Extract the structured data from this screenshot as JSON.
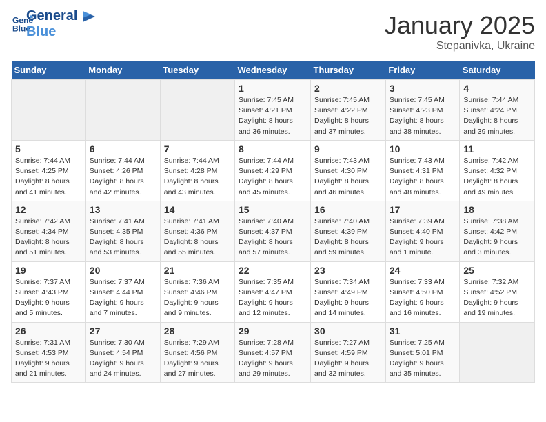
{
  "header": {
    "logo_line1": "General",
    "logo_line2": "Blue",
    "month": "January 2025",
    "location": "Stepanivka, Ukraine"
  },
  "weekdays": [
    "Sunday",
    "Monday",
    "Tuesday",
    "Wednesday",
    "Thursday",
    "Friday",
    "Saturday"
  ],
  "weeks": [
    [
      {
        "day": "",
        "info": ""
      },
      {
        "day": "",
        "info": ""
      },
      {
        "day": "",
        "info": ""
      },
      {
        "day": "1",
        "info": "Sunrise: 7:45 AM\nSunset: 4:21 PM\nDaylight: 8 hours and 36 minutes."
      },
      {
        "day": "2",
        "info": "Sunrise: 7:45 AM\nSunset: 4:22 PM\nDaylight: 8 hours and 37 minutes."
      },
      {
        "day": "3",
        "info": "Sunrise: 7:45 AM\nSunset: 4:23 PM\nDaylight: 8 hours and 38 minutes."
      },
      {
        "day": "4",
        "info": "Sunrise: 7:44 AM\nSunset: 4:24 PM\nDaylight: 8 hours and 39 minutes."
      }
    ],
    [
      {
        "day": "5",
        "info": "Sunrise: 7:44 AM\nSunset: 4:25 PM\nDaylight: 8 hours and 41 minutes."
      },
      {
        "day": "6",
        "info": "Sunrise: 7:44 AM\nSunset: 4:26 PM\nDaylight: 8 hours and 42 minutes."
      },
      {
        "day": "7",
        "info": "Sunrise: 7:44 AM\nSunset: 4:28 PM\nDaylight: 8 hours and 43 minutes."
      },
      {
        "day": "8",
        "info": "Sunrise: 7:44 AM\nSunset: 4:29 PM\nDaylight: 8 hours and 45 minutes."
      },
      {
        "day": "9",
        "info": "Sunrise: 7:43 AM\nSunset: 4:30 PM\nDaylight: 8 hours and 46 minutes."
      },
      {
        "day": "10",
        "info": "Sunrise: 7:43 AM\nSunset: 4:31 PM\nDaylight: 8 hours and 48 minutes."
      },
      {
        "day": "11",
        "info": "Sunrise: 7:42 AM\nSunset: 4:32 PM\nDaylight: 8 hours and 49 minutes."
      }
    ],
    [
      {
        "day": "12",
        "info": "Sunrise: 7:42 AM\nSunset: 4:34 PM\nDaylight: 8 hours and 51 minutes."
      },
      {
        "day": "13",
        "info": "Sunrise: 7:41 AM\nSunset: 4:35 PM\nDaylight: 8 hours and 53 minutes."
      },
      {
        "day": "14",
        "info": "Sunrise: 7:41 AM\nSunset: 4:36 PM\nDaylight: 8 hours and 55 minutes."
      },
      {
        "day": "15",
        "info": "Sunrise: 7:40 AM\nSunset: 4:37 PM\nDaylight: 8 hours and 57 minutes."
      },
      {
        "day": "16",
        "info": "Sunrise: 7:40 AM\nSunset: 4:39 PM\nDaylight: 8 hours and 59 minutes."
      },
      {
        "day": "17",
        "info": "Sunrise: 7:39 AM\nSunset: 4:40 PM\nDaylight: 9 hours and 1 minute."
      },
      {
        "day": "18",
        "info": "Sunrise: 7:38 AM\nSunset: 4:42 PM\nDaylight: 9 hours and 3 minutes."
      }
    ],
    [
      {
        "day": "19",
        "info": "Sunrise: 7:37 AM\nSunset: 4:43 PM\nDaylight: 9 hours and 5 minutes."
      },
      {
        "day": "20",
        "info": "Sunrise: 7:37 AM\nSunset: 4:44 PM\nDaylight: 9 hours and 7 minutes."
      },
      {
        "day": "21",
        "info": "Sunrise: 7:36 AM\nSunset: 4:46 PM\nDaylight: 9 hours and 9 minutes."
      },
      {
        "day": "22",
        "info": "Sunrise: 7:35 AM\nSunset: 4:47 PM\nDaylight: 9 hours and 12 minutes."
      },
      {
        "day": "23",
        "info": "Sunrise: 7:34 AM\nSunset: 4:49 PM\nDaylight: 9 hours and 14 minutes."
      },
      {
        "day": "24",
        "info": "Sunrise: 7:33 AM\nSunset: 4:50 PM\nDaylight: 9 hours and 16 minutes."
      },
      {
        "day": "25",
        "info": "Sunrise: 7:32 AM\nSunset: 4:52 PM\nDaylight: 9 hours and 19 minutes."
      }
    ],
    [
      {
        "day": "26",
        "info": "Sunrise: 7:31 AM\nSunset: 4:53 PM\nDaylight: 9 hours and 21 minutes."
      },
      {
        "day": "27",
        "info": "Sunrise: 7:30 AM\nSunset: 4:54 PM\nDaylight: 9 hours and 24 minutes."
      },
      {
        "day": "28",
        "info": "Sunrise: 7:29 AM\nSunset: 4:56 PM\nDaylight: 9 hours and 27 minutes."
      },
      {
        "day": "29",
        "info": "Sunrise: 7:28 AM\nSunset: 4:57 PM\nDaylight: 9 hours and 29 minutes."
      },
      {
        "day": "30",
        "info": "Sunrise: 7:27 AM\nSunset: 4:59 PM\nDaylight: 9 hours and 32 minutes."
      },
      {
        "day": "31",
        "info": "Sunrise: 7:25 AM\nSunset: 5:01 PM\nDaylight: 9 hours and 35 minutes."
      },
      {
        "day": "",
        "info": ""
      }
    ]
  ]
}
